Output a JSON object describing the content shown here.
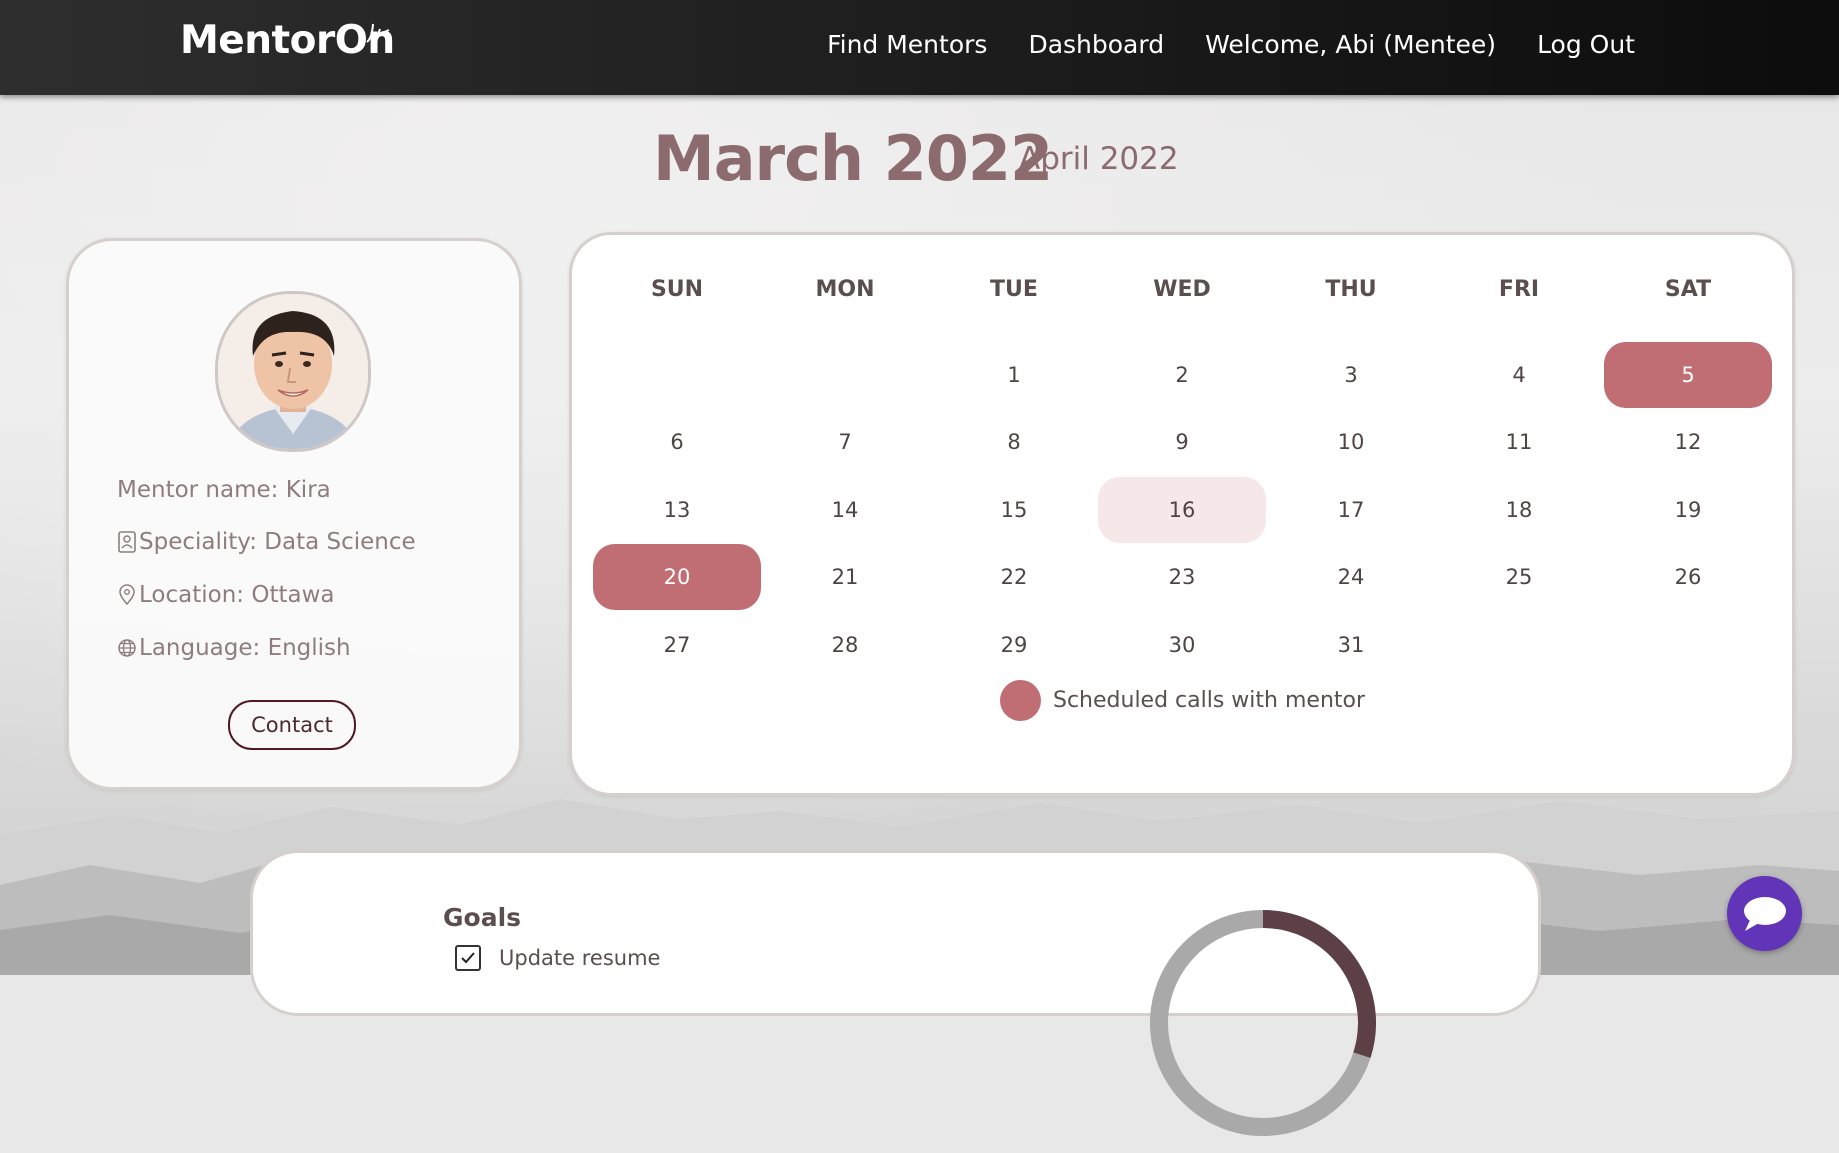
{
  "nav": {
    "logo": "MentorOn",
    "links": [
      "Find Mentors",
      "Dashboard",
      "Welcome, Abi (Mentee)",
      "Log Out"
    ]
  },
  "calendar": {
    "month_title": "March 2022",
    "next_month": "April 2022",
    "weekdays": [
      "SUN",
      "MON",
      "TUE",
      "WED",
      "THU",
      "FRI",
      "SAT"
    ],
    "first_weekday_index": 2,
    "days_in_month": 31,
    "scheduled_days": [
      5,
      20
    ],
    "highlighted_day": 16,
    "legend": "Scheduled calls with mentor",
    "accent_color": "#c06d74",
    "highlight_color": "#f6e8e9"
  },
  "mentor": {
    "name": "Mentor name: Kira",
    "speciality": "Speciality: Data Science",
    "location": "Location: Ottawa",
    "language": "Language: English",
    "contact_label": "Contact"
  },
  "goals": {
    "title": "Goals",
    "items": [
      {
        "text": "Update resume",
        "checked": true
      }
    ],
    "progress_fraction": 0.3
  },
  "colors": {
    "heading": "#8c6b6f",
    "chat": "#6134b8"
  }
}
